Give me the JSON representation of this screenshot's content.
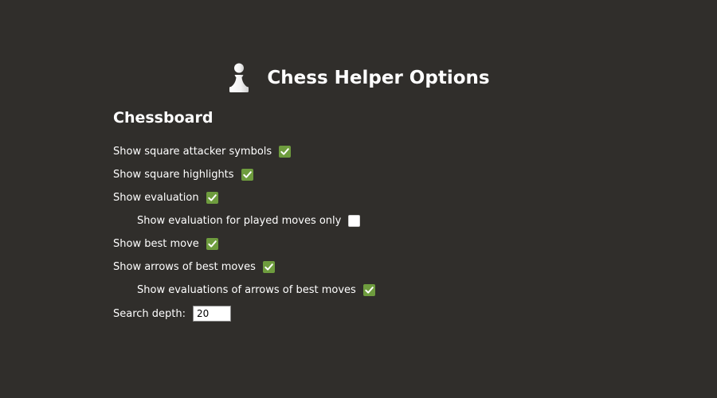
{
  "header": {
    "icon": "chess-pawn-icon",
    "title": "Chess Helper Options"
  },
  "chessboard": {
    "section_title": "Chessboard",
    "options": [
      {
        "label": "Show square attacker symbols",
        "checked": true,
        "indented": false
      },
      {
        "label": "Show square highlights",
        "checked": true,
        "indented": false
      },
      {
        "label": "Show evaluation",
        "checked": true,
        "indented": false
      },
      {
        "label": "Show evaluation for played moves only",
        "checked": false,
        "indented": true
      },
      {
        "label": "Show best move",
        "checked": true,
        "indented": false
      },
      {
        "label": "Show arrows of best moves",
        "checked": true,
        "indented": false
      },
      {
        "label": "Show evaluations of arrows of best moves",
        "checked": true,
        "indented": true
      }
    ],
    "search_depth": {
      "label": "Search depth:",
      "value": "20"
    }
  },
  "colors": {
    "background": "#302e2b",
    "checkbox_checked": "#6e9c3e",
    "text": "#ffffff"
  }
}
